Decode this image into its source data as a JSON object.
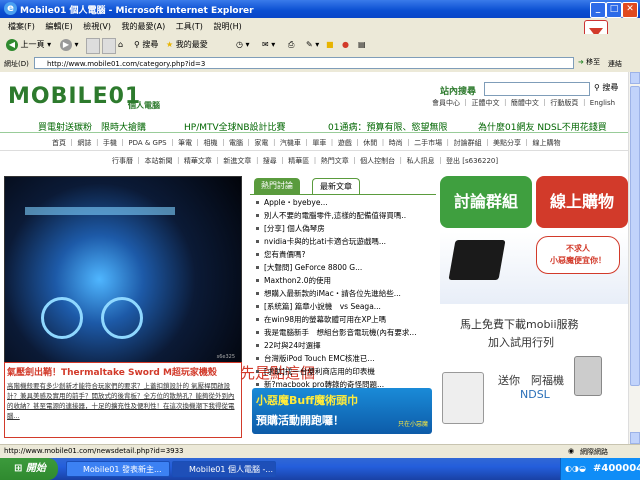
{
  "window": {
    "title": "Mobile01 個人電腦 - Microsoft Internet Explorer"
  },
  "menubar": {
    "items": [
      "檔案(F)",
      "編輯(E)",
      "檢視(V)",
      "我的最愛(A)",
      "工具(T)",
      "說明(H)"
    ]
  },
  "toolbar": {
    "back_label": "上一頁",
    "search_label": "搜尋",
    "favorites_label": "我的最愛"
  },
  "address": {
    "label": "網址(D)",
    "url": "http://www.mobile01.com/category.php?id=3",
    "go_label": "移至",
    "links_label": "連結"
  },
  "page": {
    "logo": "MOBILE01",
    "logo_sub": "個人電腦",
    "site_search": {
      "label": "站內搜尋",
      "button": "搜尋"
    },
    "member_links": "會員中心 ｜ 正體中文 ｜ 簡體中文 ｜ 行動版頁 ｜ English",
    "promo_links": [
      "買電射送碳粉　限時大搶購",
      "HP/MTV全球NB設計比賽",
      "01通病：預算有限、慾望無限",
      "為什麼01網友 NDSL不用花錢買"
    ],
    "categories": "首頁 ｜ 網誌 ｜ 手機 ｜ PDA & GPS ｜ 筆電 ｜ 相機 ｜ 電腦 ｜ 家電 ｜ 汽機車 ｜ 單車 ｜ 遊戲 ｜ 休閒 ｜ 時尚 ｜ 二手市場 ｜ 討論群組 ｜ 美點分享 ｜ 線上購物",
    "user_links": "行事曆 ｜ 本站新聞 ｜ 精華文章 ｜ 新進文章 ｜ 搜尋 ｜ 精華區 ｜ 熱門文章 ｜ 個人控制台 ｜ 私人訊息 ｜ 登出 [s636220]",
    "hero": {
      "title": "氣壓劍出鞘！Thermaltake Sword M超玩家機殼",
      "body": "高階機殼要有多少創新才能符合玩家們的要求？上蓋扣鎖設計的 氣壓桿開啟設計？兼具美感及實用的前手？開放式的後背板？全方位的散熱孔？能夠從外到內的收納？甚至電源的連接器，十足的擴充性及便利性！在這次換機潮下我得從電腦...",
      "overlay": "先是點這個",
      "watermark": "s6e325"
    },
    "tabs": [
      "熱門討論",
      "最新文章"
    ],
    "news": [
      "Apple・byebye...",
      "別人不要的電腦零件,這樣的配備值得買嗎..",
      "[分享] 個人偽琴房",
      "nvidia卡與的比ati卡適合玩遊戲嗎...",
      "您有貴價嗎?",
      "[大聲問] GeForce 8800 G...",
      "Maxthon2.0的使用",
      "想購入最新款的iMac・請各位先進給些...",
      "[系統篇] 篇章小說機　vs Seaga...",
      "在win98用的螢幕軟體可用在XP上嗎",
      "我是電腦新手　想組台影音電玩機(內有要求...",
      "22吋與24吋選擇",
      "台灣版iPod Touch EMC核准已...",
      "[求助]找一台便利商店用的印表機",
      "新?macbook pro轉錄的奇怪問題..."
    ],
    "banner_bottom": {
      "line1": "小惡魔Buff魔術頭巾",
      "line2": "預購活動開跑囉！",
      "tag": "只在小惡魔"
    },
    "side": {
      "btn_forum": "討論群組",
      "btn_shop": "線上購物",
      "ad_bubble": "不求人\n小惡魔便宜你！",
      "download_line1": "馬上免費下載mobii服務",
      "download_line2": "加入試用行列",
      "gift_line1": "送你　阿福機",
      "gift_line2": "NDSL"
    }
  },
  "statusbar": {
    "url": "http://www.mobile01.com/newsdetail.php?id=3933",
    "zone": "網際網路"
  },
  "taskbar": {
    "start_label": "開始",
    "tasks": [
      "Mobile01 發表新主...",
      "Mobile01 個人電腦 -..."
    ],
    "tray_text": "#400004"
  },
  "colors": {
    "brand_green": "#2d7a2d",
    "xp_blue": "#245edb",
    "red": "#d23a2a",
    "green_button": "#3f9f3f"
  }
}
